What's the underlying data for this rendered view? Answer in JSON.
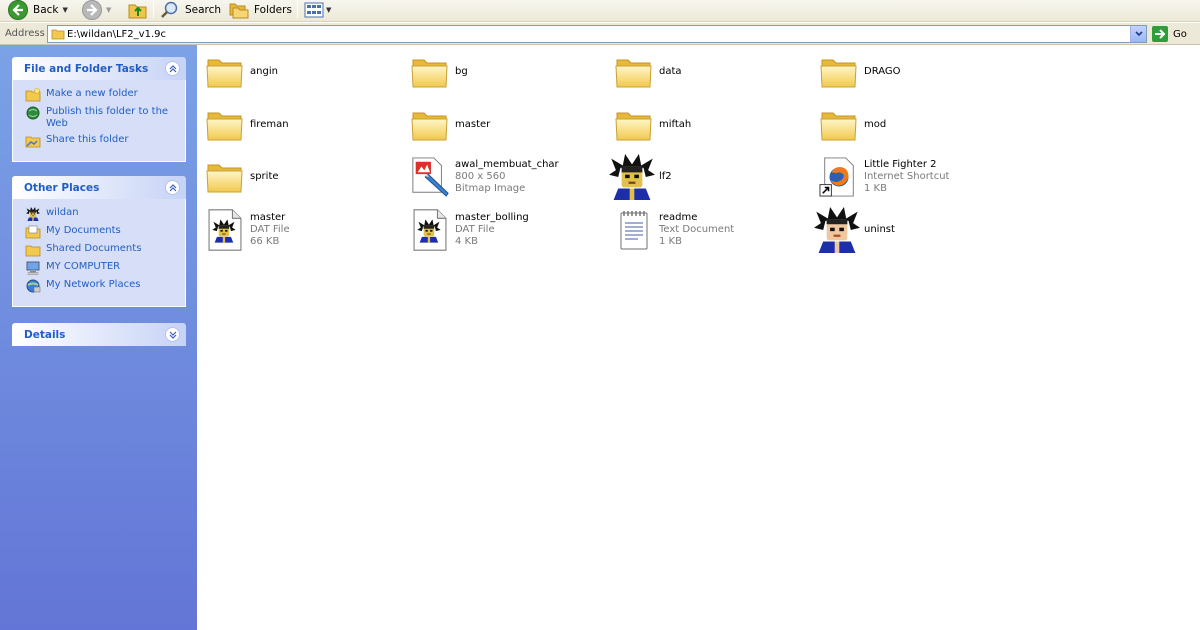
{
  "toolbar": {
    "back_label": "Back",
    "search_label": "Search",
    "folders_label": "Folders"
  },
  "address": {
    "label": "Address",
    "value": "E:\\wildan\\LF2_v1.9c",
    "go_label": "Go"
  },
  "tasks": {
    "title": "File and Folder Tasks",
    "items": [
      {
        "label": "Make a new folder",
        "icon": "new-folder-icon"
      },
      {
        "label": "Publish this folder to the Web",
        "icon": "globe-publish-icon"
      },
      {
        "label": "Share this folder",
        "icon": "share-folder-icon"
      }
    ]
  },
  "places": {
    "title": "Other Places",
    "items": [
      {
        "label": "wildan",
        "icon": "user-character-icon"
      },
      {
        "label": "My Documents",
        "icon": "my-documents-icon"
      },
      {
        "label": "Shared Documents",
        "icon": "shared-documents-icon"
      },
      {
        "label": "MY COMPUTER",
        "icon": "computer-icon"
      },
      {
        "label": "My Network Places",
        "icon": "network-places-icon"
      }
    ]
  },
  "details": {
    "title": "Details"
  },
  "files": [
    {
      "name": "angin",
      "icon": "folder-icon"
    },
    {
      "name": "bg",
      "icon": "folder-icon"
    },
    {
      "name": "data",
      "icon": "folder-icon"
    },
    {
      "name": "DRAGO",
      "icon": "folder-icon"
    },
    {
      "name": "fireman",
      "icon": "folder-icon"
    },
    {
      "name": "master",
      "icon": "folder-icon"
    },
    {
      "name": "miftah",
      "icon": "folder-icon"
    },
    {
      "name": "mod",
      "icon": "folder-icon"
    },
    {
      "name": "sprite",
      "icon": "folder-icon"
    },
    {
      "name": "awal_membuat_char",
      "type": "800 x 560",
      "size": "Bitmap Image",
      "icon": "bitmap-image-icon"
    },
    {
      "name": "lf2",
      "icon": "lf2-character-icon"
    },
    {
      "name": "Little Fighter 2",
      "type": "Internet Shortcut",
      "size": "1 KB",
      "icon": "firefox-shortcut-icon"
    },
    {
      "name": "master",
      "type": "DAT File",
      "size": "66 KB",
      "icon": "dat-file-icon"
    },
    {
      "name": "master_bolling",
      "type": "DAT File",
      "size": "4 KB",
      "icon": "dat-file-icon"
    },
    {
      "name": "readme",
      "type": "Text Document",
      "size": "1 KB",
      "icon": "text-document-icon"
    },
    {
      "name": "uninst",
      "icon": "uninstall-character-icon"
    }
  ]
}
